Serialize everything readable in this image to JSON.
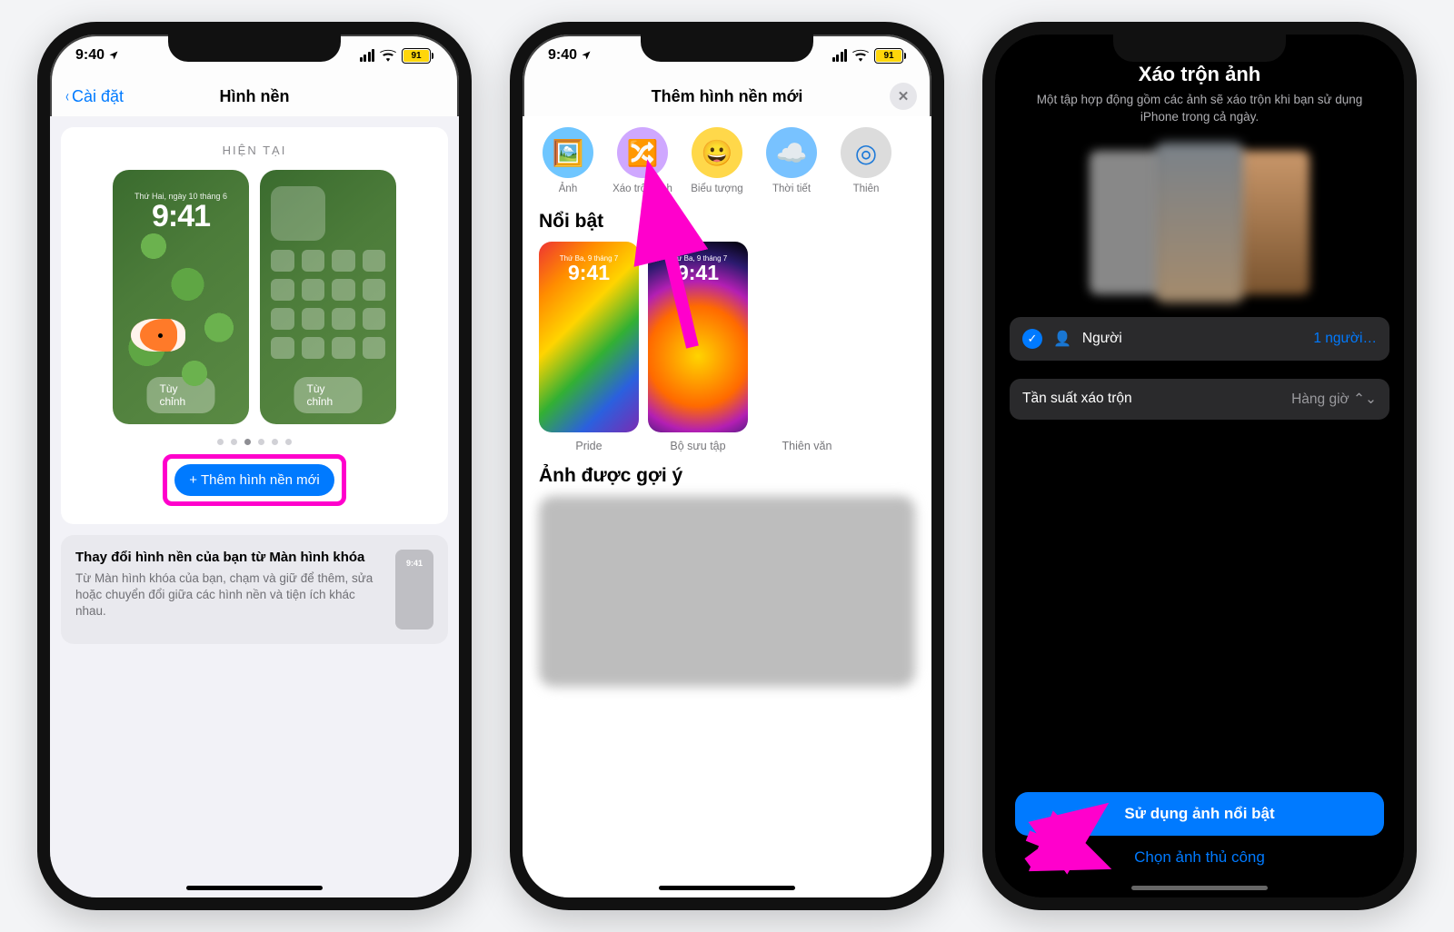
{
  "status": {
    "time": "9:40",
    "battery": "91"
  },
  "phone1": {
    "back": "Cài đặt",
    "title": "Hình nền",
    "current": "HIỆN TẠI",
    "lock_date": "Thứ Hai, ngày 10 tháng 6",
    "lock_time": "9:41",
    "customize": "Tùy chỉnh",
    "add": "Thêm hình nền mới",
    "tip_title": "Thay đổi hình nền của bạn từ Màn hình khóa",
    "tip_body": "Từ Màn hình khóa của bạn, chạm và giữ để thêm, sửa hoặc chuyển đổi giữa các hình nền và tiện ích khác nhau.",
    "tip_time": "9:41"
  },
  "phone2": {
    "title": "Thêm hình nền mới",
    "cats": [
      {
        "label": "Ảnh",
        "icon": "🖼️",
        "bg": "#6fc6ff"
      },
      {
        "label": "Xáo trộn ảnh",
        "icon": "🔀",
        "bg": "#cfa8ff"
      },
      {
        "label": "Biểu tượng",
        "icon": "😀",
        "bg": "#ffd84a"
      },
      {
        "label": "Thời tiết",
        "icon": "☁️",
        "bg": "#78c2ff"
      },
      {
        "label": "Thiên",
        "icon": "◎",
        "bg": "#dcdcdc"
      }
    ],
    "featured": "Nổi bật",
    "f_date": "Thứ Ba, 9 tháng 7",
    "f_time": "9:41",
    "featured_items": [
      {
        "title": "Pride"
      },
      {
        "title": "Bộ sưu tập"
      },
      {
        "title": "Thiên văn"
      }
    ],
    "suggested": "Ảnh được gợi ý"
  },
  "phone3": {
    "title": "Xáo trộn ảnh",
    "sub": "Một tập hợp động gồm các ảnh sẽ xáo trộn khi bạn sử dụng iPhone trong cả ngày.",
    "people_label": "Người",
    "people_val": "1 người…",
    "freq_label": "Tần suất xáo trộn",
    "freq_val": "Hàng giờ",
    "primary": "Sử dụng ảnh nổi bật",
    "secondary": "Chọn ảnh thủ công"
  }
}
